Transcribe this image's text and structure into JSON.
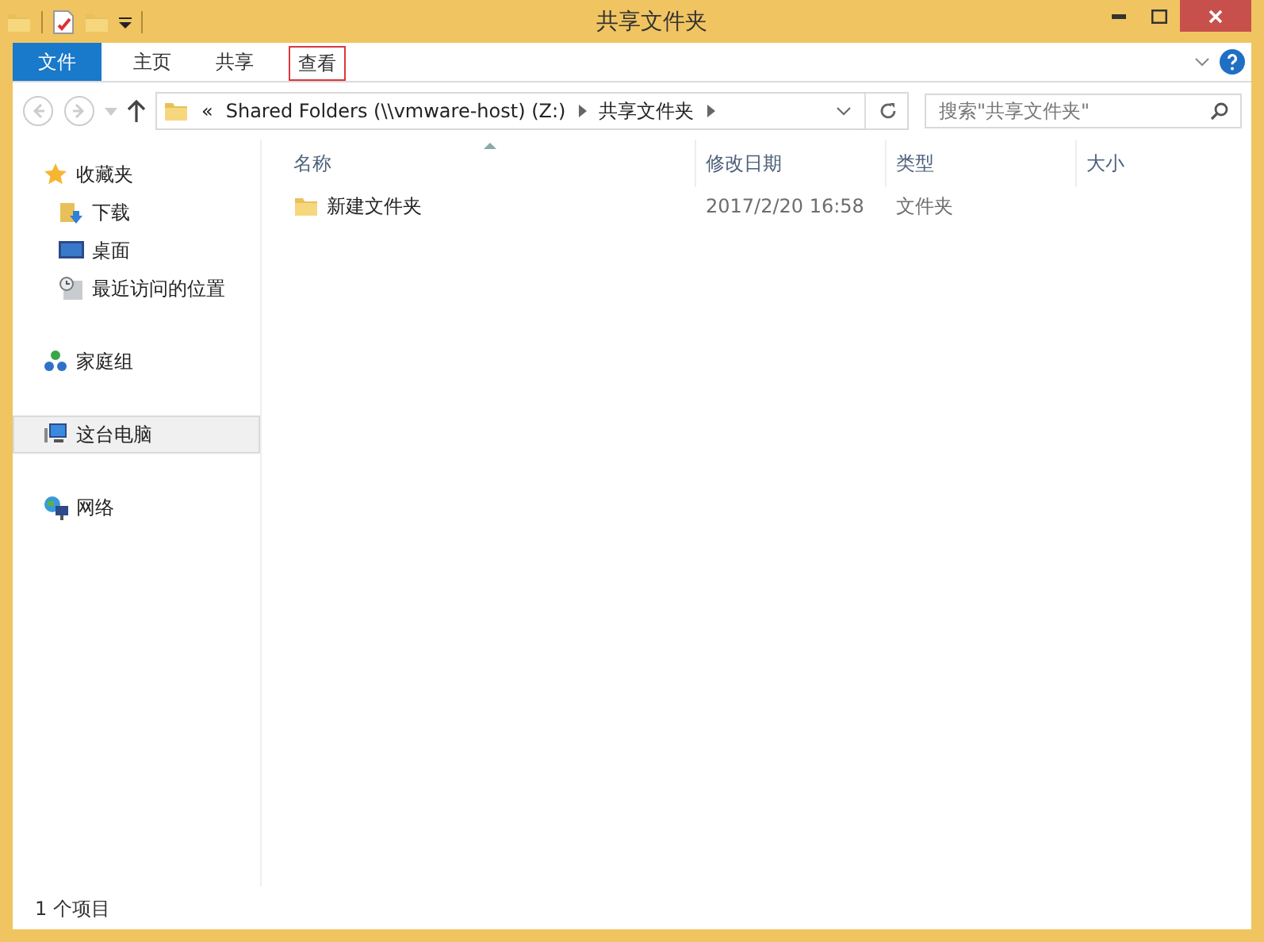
{
  "window": {
    "title": "共享文件夹"
  },
  "ribbon_tabs": [
    {
      "label": "文件",
      "kind": "file",
      "highlighted": false
    },
    {
      "label": "主页",
      "kind": "tab",
      "highlighted": false
    },
    {
      "label": "共享",
      "kind": "tab",
      "highlighted": false
    },
    {
      "label": "查看",
      "kind": "tab",
      "highlighted": true
    }
  ],
  "address_bar": {
    "path": [
      {
        "label": "«"
      },
      {
        "label": "Shared Folders (\\\\vmware-host) (Z:)"
      },
      {
        "label": "共享文件夹"
      }
    ]
  },
  "search": {
    "placeholder": "搜索\"共享文件夹\""
  },
  "sidebar": {
    "groups": [
      {
        "label": "收藏夹",
        "kind": "star",
        "selected": false,
        "children": [
          {
            "label": "下载",
            "kind": "download",
            "selected": false
          },
          {
            "label": "桌面",
            "kind": "desktop",
            "selected": false
          },
          {
            "label": "最近访问的位置",
            "kind": "recent",
            "selected": false
          }
        ]
      },
      {
        "label": "家庭组",
        "kind": "homegroup",
        "selected": false
      },
      {
        "label": "这台电脑",
        "kind": "computer",
        "selected": true
      },
      {
        "label": "网络",
        "kind": "network",
        "selected": false
      }
    ]
  },
  "table": {
    "columns": [
      "名称",
      "修改日期",
      "类型",
      "大小"
    ],
    "rows": [
      {
        "name": "新建文件夹",
        "modified": "2017/2/20 16:58",
        "type": "文件夹"
      }
    ]
  },
  "status_bar": {
    "text": "1 个项目"
  }
}
